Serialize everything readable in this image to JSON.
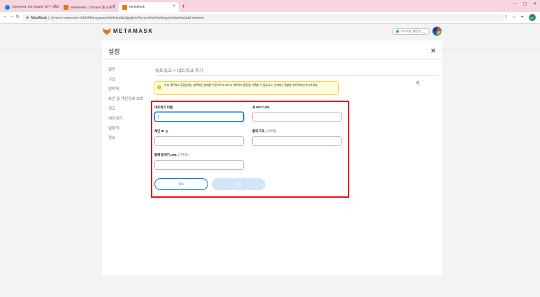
{
  "browser": {
    "tabs": [
      {
        "title": "OpenSea, the largest NFT mark",
        "color": "#2081e2"
      },
      {
        "title": "MetaMask - Chrome 웹 스토어",
        "color": "#e2761b"
      },
      {
        "title": "MetaMask",
        "color": "#e2761b"
      }
    ],
    "site_label": "MetaMask",
    "url": "chrome-extension://nkbihfbeogaeaoehlefnkodbefgpgknn/home.html#settings/networks/add-network",
    "profile_initials": "CH"
  },
  "header": {
    "wordmark": "METAMASK",
    "network": "이더리움 메인넷"
  },
  "settings": {
    "title": "설정",
    "sidebar": [
      "일반",
      "고급",
      "연락처",
      "보안 및 개인정보 보호",
      "경고",
      "네트워크",
      "실험적",
      "정보"
    ],
    "breadcrumb": "네트워크  >  네트워크 추가"
  },
  "warning": {
    "text": "악성 네트워크 공급업체는 블록체인 상태를 거짓으로 보고하고 네트워크 활동을 기록할 수 있습니다. 신뢰하는 맞춤형 네트워크만 추가하세요."
  },
  "form": {
    "network_name_label": "네트워크 이름",
    "rpc_url_label": "새 RPC URL",
    "chain_id_label": "체인 ID",
    "currency_symbol_label": "통화 기호",
    "explorer_url_label": "블록 탐색기 URL",
    "optional": "(선택적)",
    "cancel": "취소",
    "save": "저장"
  }
}
